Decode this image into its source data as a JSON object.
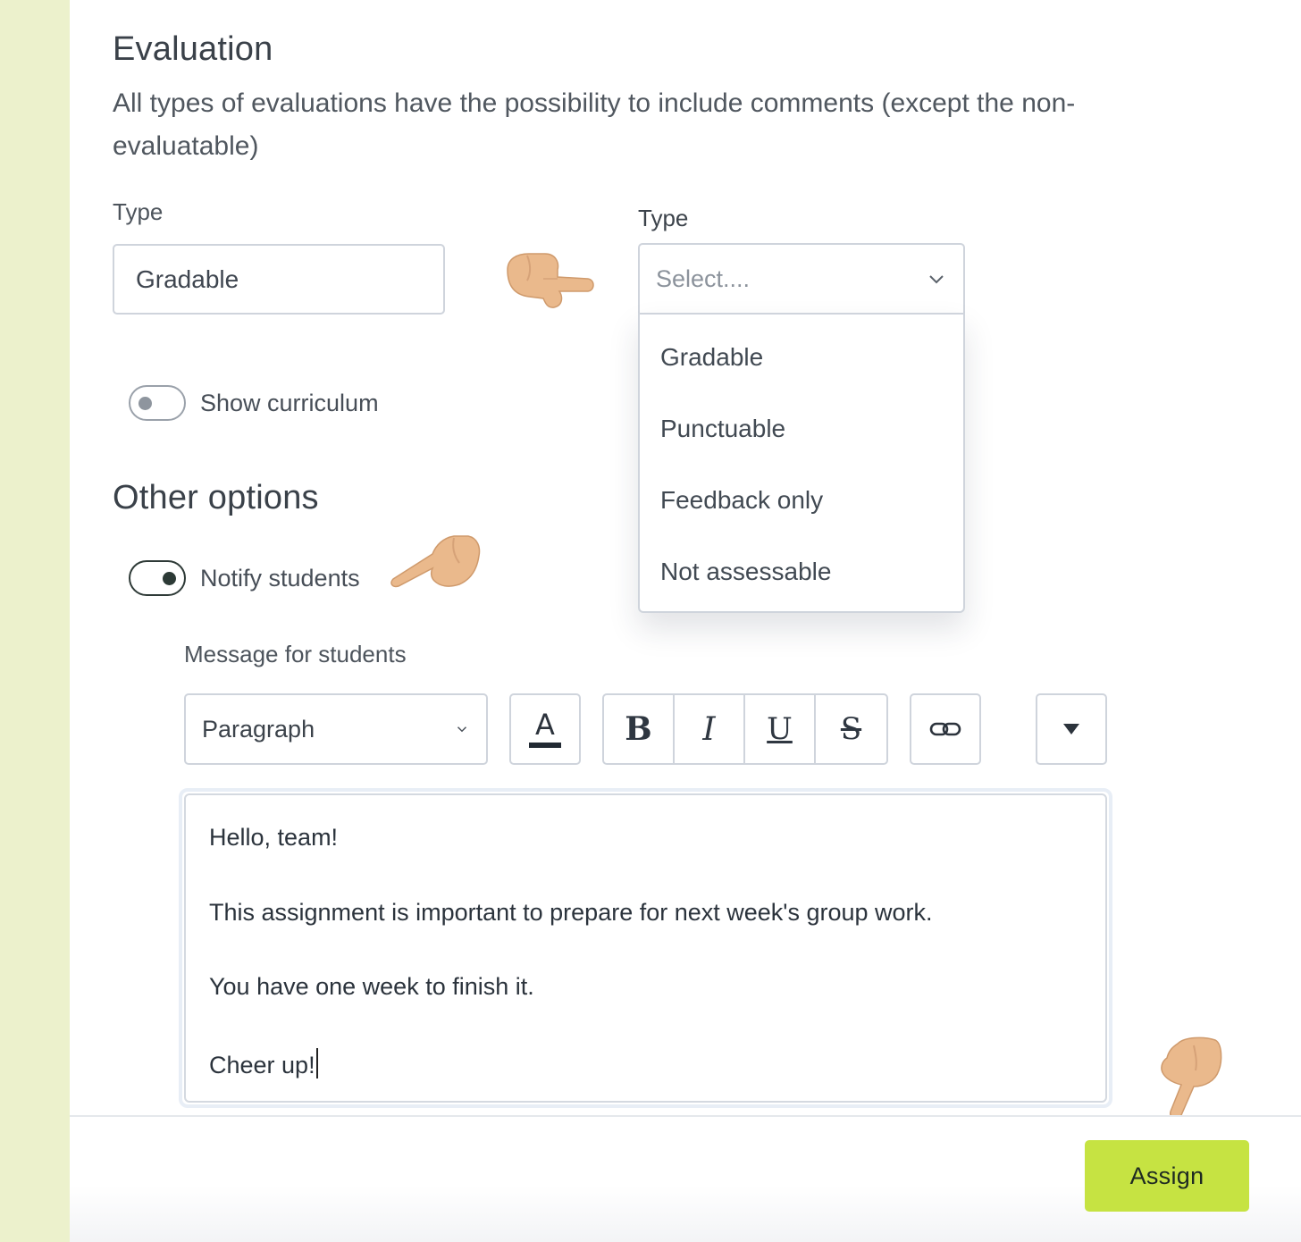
{
  "evaluation": {
    "title": "Evaluation",
    "description": "All types of evaluations have the possibility to include comments (except the non-evaluatable)",
    "type_field": {
      "label": "Type",
      "value": "Gradable"
    },
    "type_select": {
      "label": "Type",
      "placeholder": "Select....",
      "options": [
        "Gradable",
        "Punctuable",
        "Feedback only",
        "Not assessable"
      ]
    },
    "show_curriculum": {
      "label": "Show curriculum",
      "on": false
    }
  },
  "other_options": {
    "title": "Other options",
    "notify_students": {
      "label": "Notify students",
      "on": true
    },
    "message_label": "Message for students"
  },
  "toolbar": {
    "block_format": "Paragraph",
    "color_glyph": "A",
    "bold_glyph": "B",
    "italic_glyph": "I",
    "underline_glyph": "U",
    "strike_glyph": "S"
  },
  "editor": {
    "lines": [
      "Hello, team!",
      "This assignment is important to prepare for next week's group work.",
      "You have one week to finish it.",
      "Cheer up!"
    ]
  },
  "footer": {
    "assign_label": "Assign"
  },
  "colors": {
    "sidebar": "#ecf1cc",
    "accent": "#c6e342",
    "text": "#3f4650",
    "border": "#cfd4dc"
  },
  "icons": [
    "chevron-down-icon",
    "text-color-icon",
    "bold-icon",
    "italic-icon",
    "underline-icon",
    "strikethrough-icon",
    "link-icon",
    "caret-down-icon",
    "pointing-hand-icon"
  ]
}
